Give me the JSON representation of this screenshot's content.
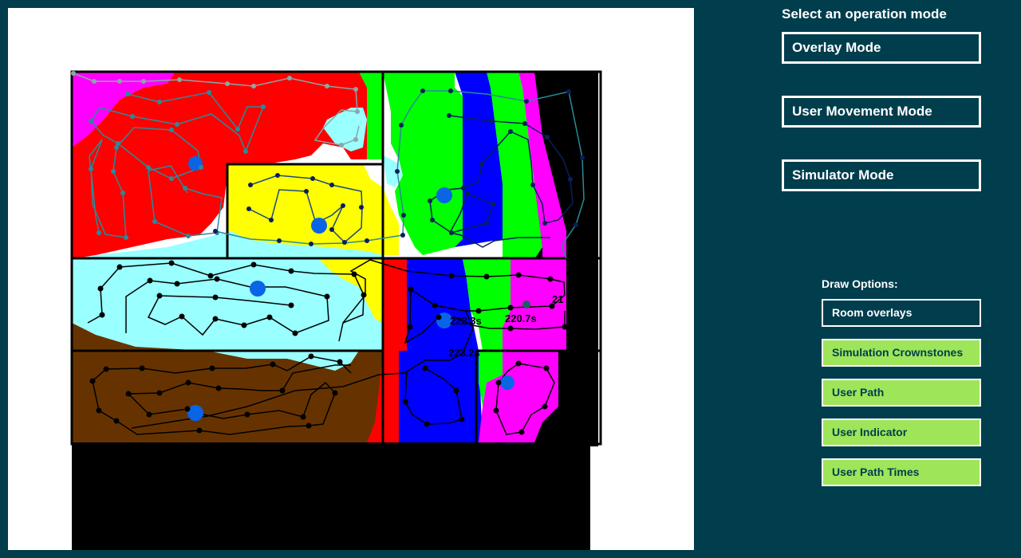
{
  "sidebar": {
    "title": "Select an operation mode",
    "modes": [
      {
        "label": "Overlay Mode"
      },
      {
        "label": "User Movement Mode"
      },
      {
        "label": "Simulator Mode"
      }
    ],
    "draw_title": "Draw Options:",
    "options": [
      {
        "label": "Room overlays",
        "active": false
      },
      {
        "label": "Simulation Crownstones",
        "active": true
      },
      {
        "label": "User Path",
        "active": true
      },
      {
        "label": "User Indicator",
        "active": true
      },
      {
        "label": "User Path Times",
        "active": true
      }
    ]
  },
  "map": {
    "time_labels": [
      "222.3s",
      "220.7s",
      "223.2s",
      "21"
    ],
    "colors": {
      "magenta": "#ff00ff",
      "red": "#ff0000",
      "green": "#00ff00",
      "blue": "#0000ff",
      "yellow": "#ffff00",
      "cyan": "#99ffff",
      "brown": "#663300",
      "black": "#000000",
      "crownstone": "#0a64e6",
      "path_teal": "#2a8a9a",
      "path_gray": "#8aa7a7",
      "path_navy": "#0a1f5a",
      "path_black": "#000000"
    }
  }
}
